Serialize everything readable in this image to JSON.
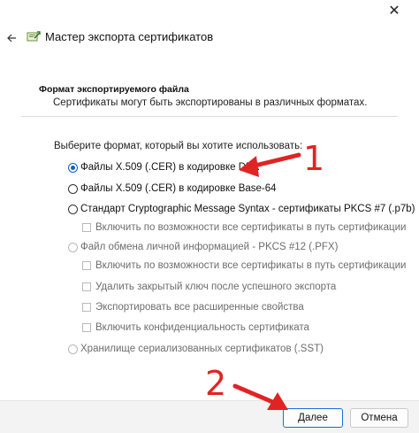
{
  "window": {
    "close_glyph": "✕",
    "back_icon": "back-arrow-icon",
    "wizard_icon": "certificate-wizard-icon",
    "title": "Мастер экспорта сертификатов"
  },
  "section": {
    "title": "Формат экспортируемого файла",
    "description": "Сертификаты могут быть экспортированы в различных форматах."
  },
  "prompt": "Выберите формат, который вы хотите использовать:",
  "options": {
    "der": {
      "label": "Файлы X.509 (.CER) в кодировке DER",
      "selected": true
    },
    "base64": {
      "label": "Файлы X.509 (.CER) в кодировке Base-64",
      "selected": false
    },
    "pkcs7": {
      "label": "Стандарт Cryptographic Message Syntax - сертификаты PKCS #7 (.p7b)",
      "selected": false
    },
    "pkcs7_include_all": "Включить по возможности все сертификаты в путь сертификации",
    "pfx": {
      "label": "Файл обмена личной информацией - PKCS #12 (.PFX)",
      "enabled": false
    },
    "pfx_include_all": "Включить по возможности все сертификаты в путь сертификации",
    "pfx_delete_key": "Удалить закрытый ключ после успешного экспорта",
    "pfx_export_props": "Экспортировать все расширенные свойства",
    "pfx_privacy": "Включить конфиденциальность сертификата",
    "sst": {
      "label": "Хранилище сериализованных сертификатов (.SST)",
      "enabled": false
    }
  },
  "buttons": {
    "next": "Далее",
    "cancel": "Отмена"
  },
  "annotations": {
    "marker_1": "1",
    "marker_2": "2",
    "color": "#e02424"
  },
  "colors": {
    "accent": "#0f5ec9",
    "footer_bg": "#f3f3f3"
  }
}
